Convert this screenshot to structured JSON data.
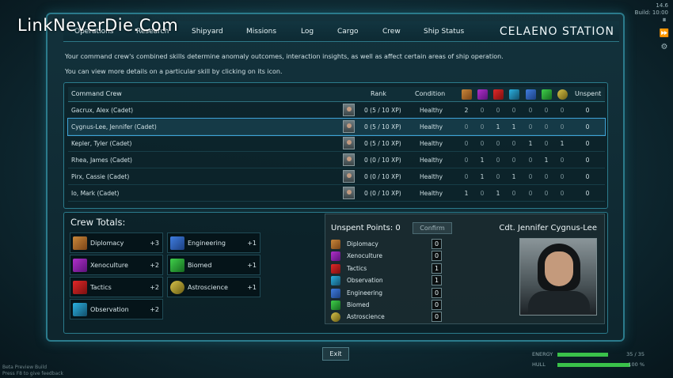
{
  "watermark": "LinkNeverDie.Com",
  "build": {
    "line1": "14.6",
    "line2": "Build: 10:00"
  },
  "nav": {
    "tabs": [
      "Operations",
      "Research",
      "Shipyard",
      "Missions",
      "Log",
      "Cargo",
      "Crew",
      "Ship Status"
    ],
    "station": "CELAENO STATION"
  },
  "intro": {
    "line1": "Your command crew's combined skills determine anomaly outcomes, interaction insights, as well as affect certain areas of ship operation.",
    "line2": "You can view more details on a particular skill by clicking on its icon."
  },
  "crew_table": {
    "headers": {
      "name": "Command Crew",
      "rank": "Rank",
      "condition": "Condition",
      "unspent": "Unspent"
    },
    "skill_icons": [
      "diplomacy-icon",
      "xenoculture-icon",
      "tactics-icon",
      "observation-icon",
      "engineering-icon",
      "biomed-icon",
      "astroscience-icon"
    ],
    "rows": [
      {
        "name": "Gacrux, Alex (Cadet)",
        "rank": "0 (5 / 10 XP)",
        "condition": "Healthy",
        "skills": [
          "2",
          "0",
          "0",
          "0",
          "0",
          "0",
          "0"
        ],
        "unspent": "0"
      },
      {
        "name": "Cygnus-Lee, Jennifer (Cadet)",
        "rank": "0 (5 / 10 XP)",
        "condition": "Healthy",
        "skills": [
          "0",
          "0",
          "1",
          "1",
          "0",
          "0",
          "0"
        ],
        "unspent": "0"
      },
      {
        "name": "Kepler, Tyler (Cadet)",
        "rank": "0 (5 / 10 XP)",
        "condition": "Healthy",
        "skills": [
          "0",
          "0",
          "0",
          "0",
          "1",
          "0",
          "1"
        ],
        "unspent": "0"
      },
      {
        "name": "Rhea, James (Cadet)",
        "rank": "0 (0 / 10 XP)",
        "condition": "Healthy",
        "skills": [
          "0",
          "1",
          "0",
          "0",
          "0",
          "1",
          "0"
        ],
        "unspent": "0"
      },
      {
        "name": "Pirx, Cassie (Cadet)",
        "rank": "0 (0 / 10 XP)",
        "condition": "Healthy",
        "skills": [
          "0",
          "1",
          "0",
          "1",
          "0",
          "0",
          "0"
        ],
        "unspent": "0"
      },
      {
        "name": "Io, Mark (Cadet)",
        "rank": "0 (0 / 10 XP)",
        "condition": "Healthy",
        "skills": [
          "1",
          "0",
          "1",
          "0",
          "0",
          "0",
          "0"
        ],
        "unspent": "0"
      }
    ]
  },
  "totals": {
    "title": "Crew Totals:",
    "items": [
      {
        "label": "Diplomacy",
        "value": "+3",
        "icon": "diplomacy-icon"
      },
      {
        "label": "Xenoculture",
        "value": "+2",
        "icon": "xenoculture-icon"
      },
      {
        "label": "Tactics",
        "value": "+2",
        "icon": "tactics-icon"
      },
      {
        "label": "Observation",
        "value": "+2",
        "icon": "observation-icon"
      },
      {
        "label": "Engineering",
        "value": "+1",
        "icon": "engineering-icon"
      },
      {
        "label": "Biomed",
        "value": "+1",
        "icon": "biomed-icon"
      },
      {
        "label": "Astroscience",
        "value": "+1",
        "icon": "astroscience-icon"
      }
    ]
  },
  "unspent": {
    "title": "Unspent Points: 0",
    "confirm": "Confirm",
    "officer": "Cdt. Jennifer Cygnus-Lee",
    "skills": [
      {
        "label": "Diplomacy",
        "value": "0"
      },
      {
        "label": "Xenoculture",
        "value": "0"
      },
      {
        "label": "Tactics",
        "value": "1"
      },
      {
        "label": "Observation",
        "value": "1"
      },
      {
        "label": "Engineering",
        "value": "0"
      },
      {
        "label": "Biomed",
        "value": "0"
      },
      {
        "label": "Astroscience",
        "value": "0"
      }
    ]
  },
  "exit": "Exit",
  "hud": {
    "energy_label": "ENERGY",
    "energy_value": "35 / 35",
    "hull_label": "HULL",
    "hull_value": "100 %"
  },
  "beta": {
    "line1": "Beta Preview Build",
    "line2": "Press F8 to give feedback"
  }
}
